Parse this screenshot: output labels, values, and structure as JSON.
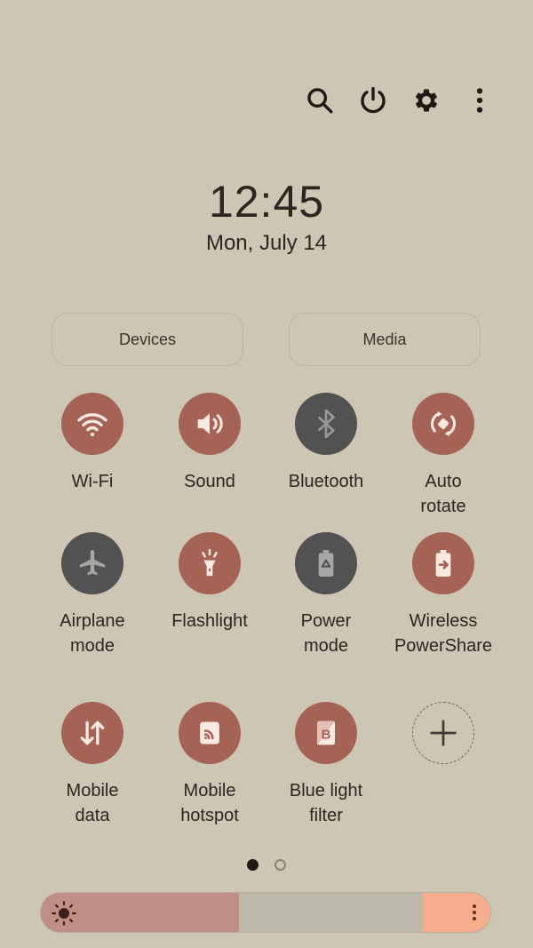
{
  "header": {
    "icons": [
      "search-icon",
      "power-icon",
      "settings-icon",
      "more-options-icon"
    ]
  },
  "clock": {
    "time": "12:45",
    "date": "Mon, July 14"
  },
  "buttons": {
    "devices": "Devices",
    "media": "Media"
  },
  "tiles": [
    {
      "label": "Wi-Fi",
      "icon": "wifi-icon",
      "state": "on"
    },
    {
      "label": "Sound",
      "icon": "volume-icon",
      "state": "on"
    },
    {
      "label": "Bluetooth",
      "icon": "bluetooth-icon",
      "state": "off"
    },
    {
      "label": "Auto\nrotate",
      "icon": "auto-rotate-icon",
      "state": "on"
    },
    {
      "label": "Airplane\nmode",
      "icon": "airplane-icon",
      "state": "off"
    },
    {
      "label": "Flashlight",
      "icon": "flashlight-icon",
      "state": "on"
    },
    {
      "label": "Power\nmode",
      "icon": "power-mode-icon",
      "state": "off"
    },
    {
      "label": "Wireless\nPowerShare",
      "icon": "wireless-powershare-icon",
      "state": "on"
    },
    {
      "label": "Mobile\ndata",
      "icon": "mobile-data-icon",
      "state": "on"
    },
    {
      "label": "Mobile\nhotspot",
      "icon": "hotspot-icon",
      "state": "on"
    },
    {
      "label": "Blue light\nfilter",
      "icon": "blue-light-filter-icon",
      "state": "on"
    },
    {
      "label": "",
      "icon": "add-icon",
      "state": "add"
    }
  ],
  "pager": {
    "current_page": 1,
    "total_pages": 2
  },
  "brightness": {
    "level_percent": 44
  },
  "colors": {
    "background": "#cdc6b5",
    "tile_on": "#a56355",
    "tile_off": "#535252",
    "brightness_fill": "#bf8e84",
    "brightness_end": "#f5ad8e"
  }
}
